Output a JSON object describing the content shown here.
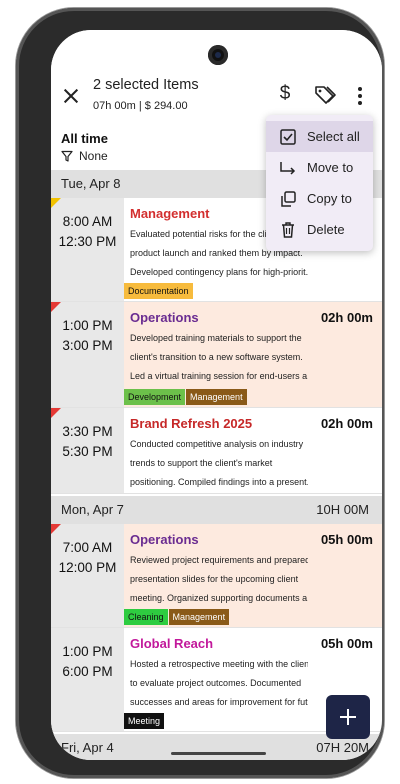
{
  "header": {
    "title": "2 selected Items",
    "subtitle": "07h 00m | $ 294.00"
  },
  "menu": {
    "items": [
      {
        "label": "Select all",
        "icon": "checkbox-checked-icon",
        "active": true
      },
      {
        "label": "Move to",
        "icon": "move-arrow-icon",
        "active": false
      },
      {
        "label": "Copy to",
        "icon": "copy-icon",
        "active": false
      },
      {
        "label": "Delete",
        "icon": "trash-icon",
        "active": false
      }
    ]
  },
  "filter": {
    "range": "All time",
    "filter_label": "None"
  },
  "days": [
    {
      "label": "Tue, Apr 8",
      "total": "",
      "entries": [
        {
          "start": "8:00 AM",
          "end": "12:30 PM",
          "project": "Management",
          "project_color": "#d32f2f",
          "duration": "",
          "lines": [
            "Evaluated potential risks for the client's",
            "product launch and ranked them by impact.",
            "Developed contingency plans for high-priorit..."
          ],
          "tags": [
            {
              "label": "Documentation",
              "color": "#f7bb3d"
            }
          ],
          "tinted": false,
          "flag": "amber"
        },
        {
          "start": "1:00 PM",
          "end": "3:00 PM",
          "project": "Operations",
          "project_color": "#6a2c91",
          "duration": "02h 00m",
          "lines": [
            "Developed training materials to support the",
            "client's transition to a new software system.",
            "Led a virtual training session for end-users a..."
          ],
          "tags": [
            {
              "label": "Development",
              "color": "#6cc04a"
            },
            {
              "label": "Management",
              "color": "#8a5a18"
            }
          ],
          "tinted": true,
          "flag": "red"
        },
        {
          "start": "3:30 PM",
          "end": "5:30 PM",
          "project": "Brand Refresh 2025",
          "project_color": "#c62828",
          "duration": "02h 00m",
          "lines": [
            "Conducted competitive analysis on industry",
            "trends to support the client's market",
            "positioning. Compiled findings into a present..."
          ],
          "tags": [],
          "tinted": false,
          "flag": "red"
        }
      ]
    },
    {
      "label": "Mon, Apr 7",
      "total": "10H 00M",
      "entries": [
        {
          "start": "7:00 AM",
          "end": "12:00 PM",
          "project": "Operations",
          "project_color": "#6a2c91",
          "duration": "05h 00m",
          "lines": [
            "Reviewed project requirements and prepared",
            "presentation slides for the upcoming client",
            "meeting. Organized supporting documents a..."
          ],
          "tags": [
            {
              "label": "Cleaning",
              "color": "#2ecc40"
            },
            {
              "label": "Management",
              "color": "#8a5a18"
            }
          ],
          "tinted": true,
          "flag": "red"
        },
        {
          "start": "1:00 PM",
          "end": "6:00 PM",
          "project": "Global Reach",
          "project_color": "#c2189b",
          "duration": "05h 00m",
          "lines": [
            "Hosted a retrospective meeting with the client",
            "to evaluate project outcomes. Documented",
            "successes and areas for improvement for fut..."
          ],
          "tags": [
            {
              "label": "Meeting",
              "color": "#111111"
            }
          ],
          "tinted": false,
          "flag": "none"
        }
      ]
    },
    {
      "label": "Fri, Apr 4",
      "total": "07H 20M",
      "entries": []
    }
  ],
  "fab_label": "+",
  "currency_symbol": "$"
}
